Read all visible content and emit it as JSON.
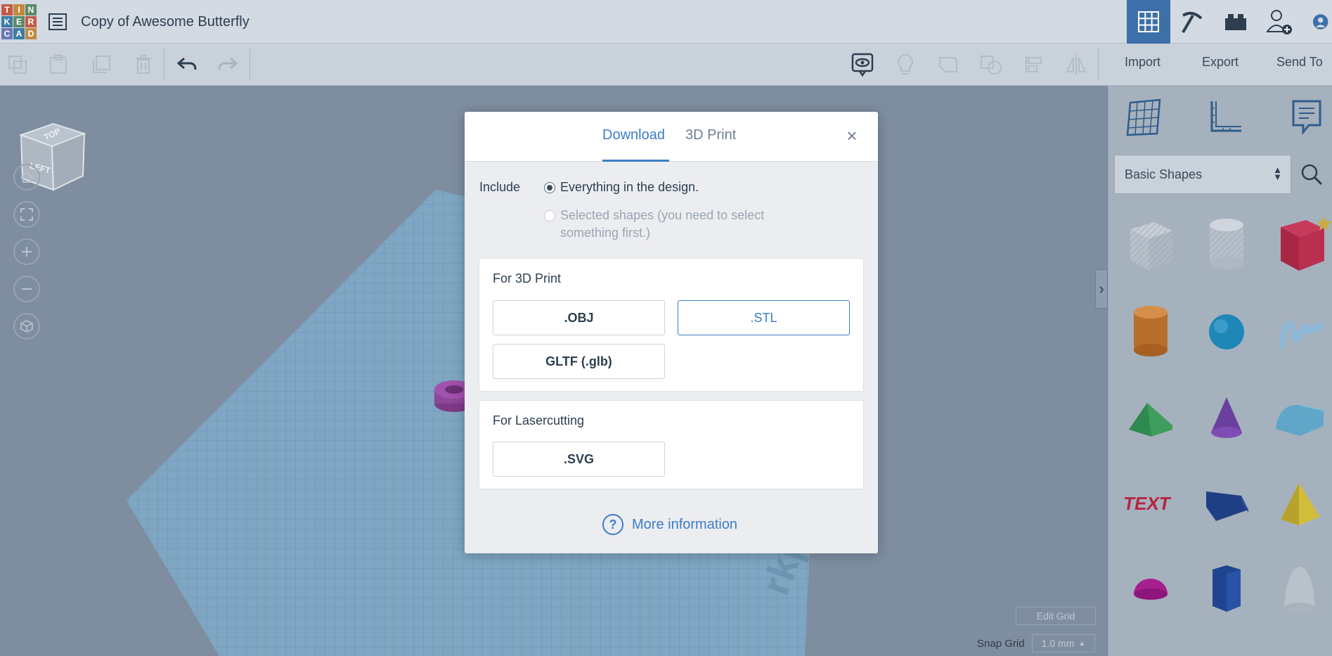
{
  "header": {
    "logo_letters": [
      "T",
      "I",
      "N",
      "K",
      "E",
      "R",
      "C",
      "A",
      "D"
    ],
    "design_title": "Copy of Awesome Butterfly",
    "buttons": [
      {
        "name": "3d-design-icon",
        "active": true
      },
      {
        "name": "pickaxe-icon",
        "active": false
      },
      {
        "name": "bricks-icon",
        "active": false
      },
      {
        "name": "add-user-icon",
        "active": false
      },
      {
        "name": "profile-avatar-icon",
        "active": false
      }
    ]
  },
  "toolbar": {
    "import_label": "Import",
    "export_label": "Export",
    "send_to_label": "Send To"
  },
  "workplane": {
    "view_cube_label_top": "TOP",
    "view_cube_label_left": "LEFT",
    "edit_grid_label": "Edit Grid",
    "snap_grid_label": "Snap Grid",
    "snap_grid_value": "1.0 mm",
    "workplane_text": "rkpla"
  },
  "shapes_panel": {
    "category": "Basic Shapes",
    "shapes": [
      "Box Hole",
      "Cylinder Hole",
      "Box",
      "Cylinder",
      "Sphere",
      "Scribble",
      "Roof",
      "Cone",
      "Round Roof",
      "Text",
      "Wedge",
      "Pyramid",
      "Half Sphere",
      "Polygon",
      "Paraboloid"
    ]
  },
  "modal": {
    "tabs": [
      {
        "label": "Download",
        "active": true
      },
      {
        "label": "3D Print",
        "active": false
      }
    ],
    "close_symbol": "×",
    "include_label": "Include",
    "option_everything": "Everything in the design.",
    "option_selected_line1": "Selected shapes (you need to select",
    "option_selected_line2": "something first.)",
    "print_section": {
      "title": "For 3D Print",
      "formats": [
        ".OBJ",
        ".STL",
        "GLTF (.glb)"
      ],
      "selected": ".STL"
    },
    "laser_section": {
      "title": "For Lasercutting",
      "formats": [
        ".SVG"
      ]
    },
    "more_info_label": "More information",
    "more_info_symbol": "?"
  },
  "colors": {
    "accent": "#3d7cc9",
    "active_header": "#3d6fa8",
    "overlay_bg": "#7e8ea0"
  }
}
